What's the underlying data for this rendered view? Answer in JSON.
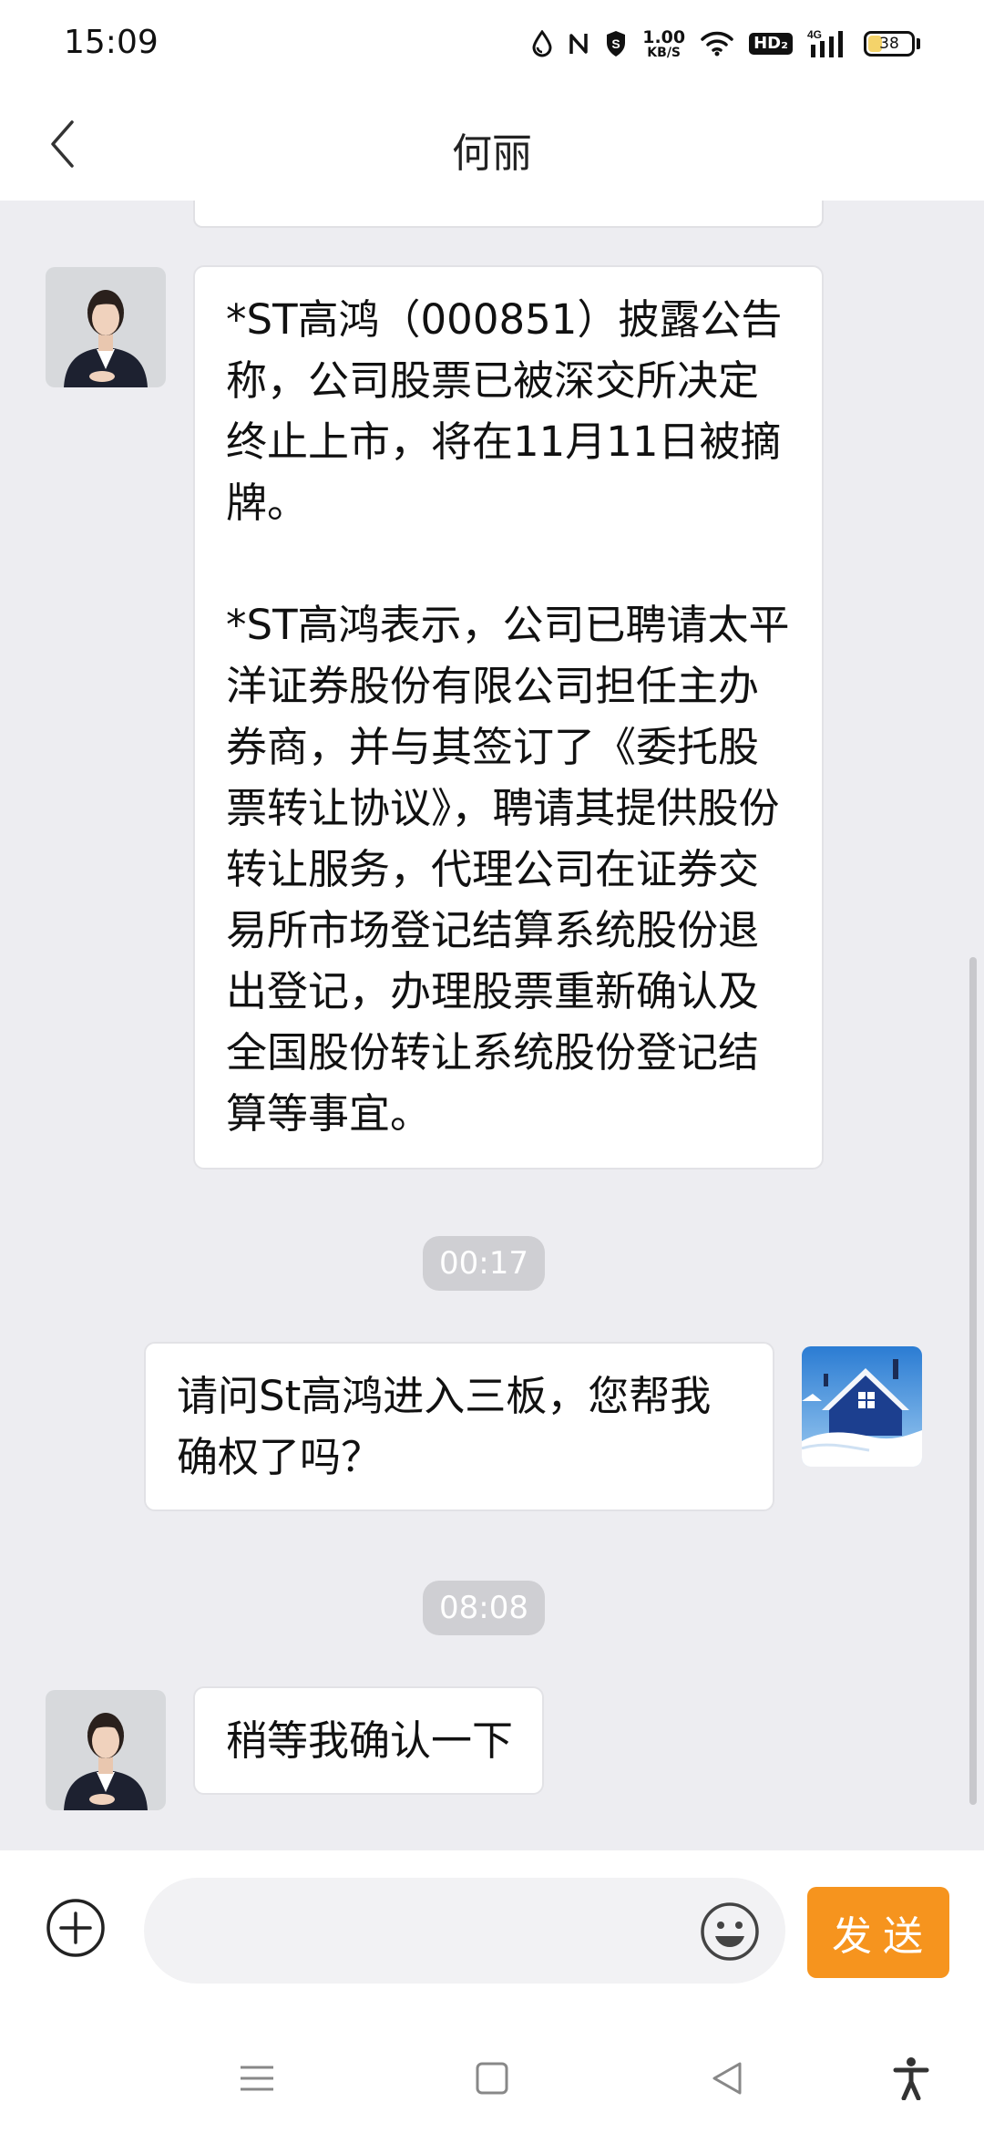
{
  "status_bar": {
    "time": "15:09",
    "net_speed_value": "1.00",
    "net_speed_unit": "KB/S",
    "hd_label": "HD₂",
    "signal_label": "4G",
    "battery_level": "38",
    "battery_fraction": 0.38,
    "battery_color": "#f4d36a"
  },
  "header": {
    "title": "何丽"
  },
  "messages": {
    "m1": {
      "p1": "*ST高鸿（000851）披露公告称，公司股票已被深交所决定终止上市，将在11月11日被摘牌。",
      "p2": "*ST高鸿表示，公司已聘请太平洋证券股份有限公司担任主办券商，并与其签订了《委托股票转让协议》，聘请其提供股份转让服务，代理公司在证券交易所市场登记结算系统股份退出登记，办理股票重新确认及全国股份转让系统股份登记结算等事宜。"
    },
    "t1": "00:17",
    "m2": "请问St高鸿进入三板，您帮我确权了吗？",
    "t2": "08:08",
    "m3": "稍等我确认一下"
  },
  "input_bar": {
    "value": "",
    "send_label": "发送",
    "send_color": "#f6941e"
  },
  "icons": {
    "back": "chevron-left-icon",
    "plus": "plus-circle-icon",
    "emoji": "smiley-icon",
    "nav_menu": "menu-icon",
    "nav_home": "square-icon",
    "nav_back": "triangle-back-icon",
    "nav_accessibility": "accessibility-icon"
  }
}
